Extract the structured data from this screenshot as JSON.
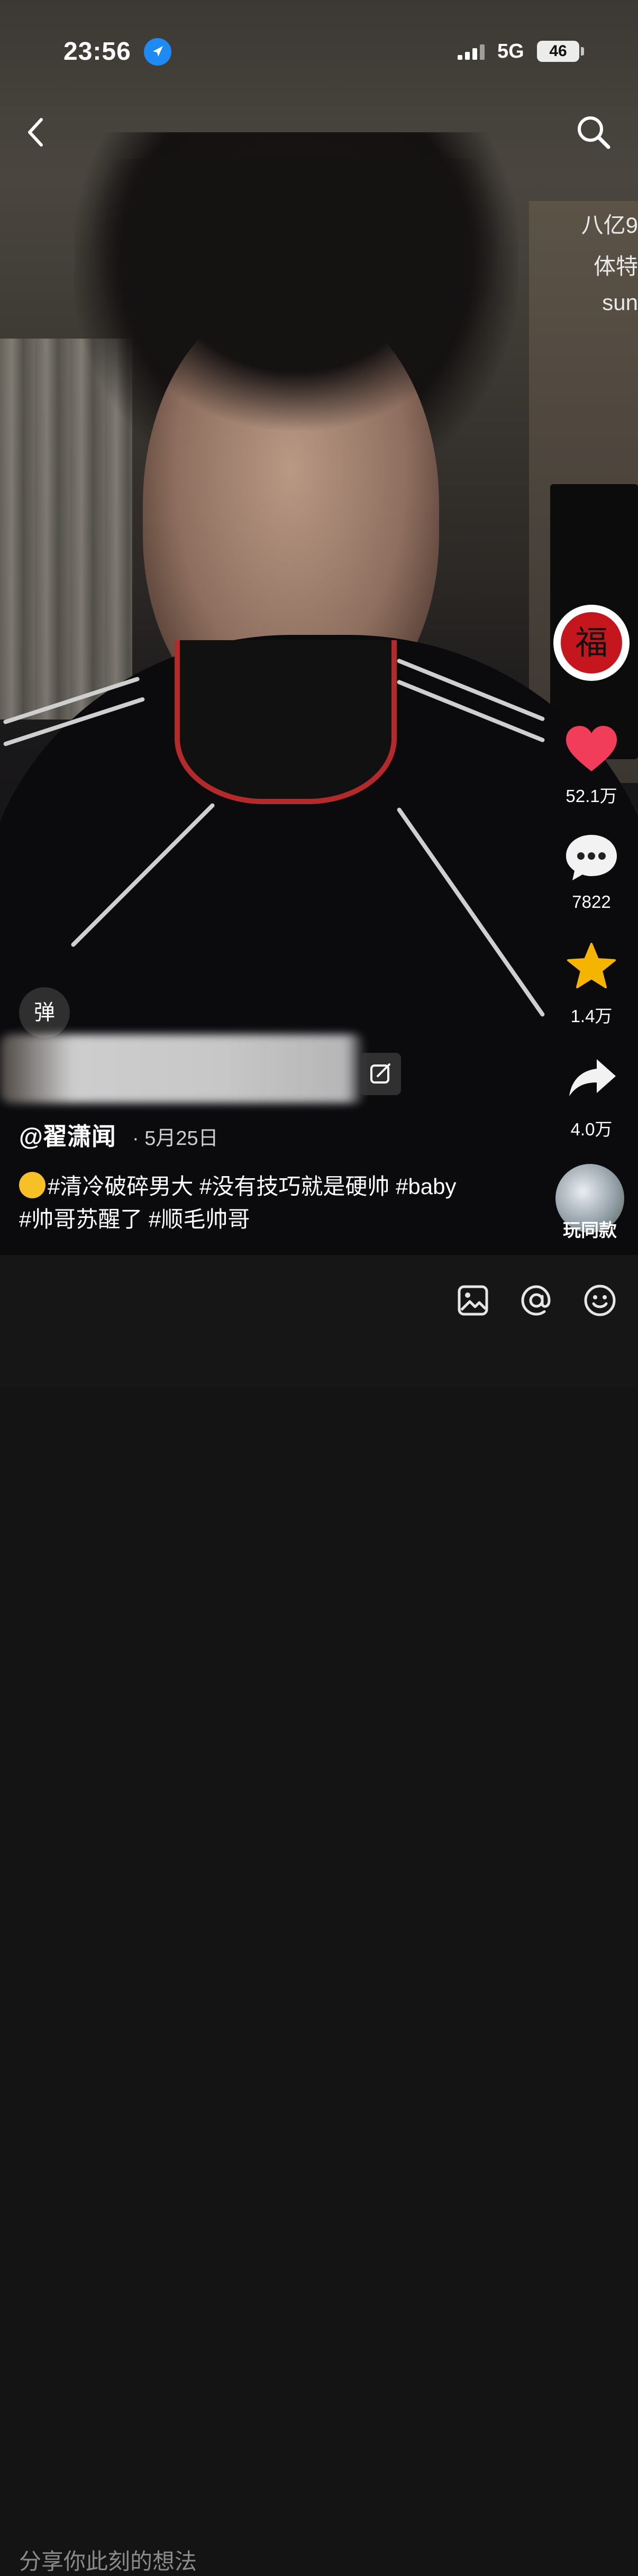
{
  "status_bar": {
    "time": "23:56",
    "network": "5G",
    "battery": "46"
  },
  "side_overlay_text": [
    "八亿9",
    "体特",
    "sun"
  ],
  "actions": {
    "like_count": "52.1万",
    "comment_count": "7822",
    "favorite_count": "1.4万",
    "share_count": "4.0万",
    "badge_char": "福"
  },
  "danmu_label": "弹",
  "post": {
    "author": "@翟潇闻",
    "date": "· 5月25日",
    "caption_line1": "#清冷破碎男大 #没有技巧就是硬帅 #baby",
    "caption_line2": "#帅哥苏醒了  #顺毛帅哥"
  },
  "same_style_label": "玩同款",
  "comment_bar": {
    "placeholder": "分享你此刻的想法"
  },
  "colors": {
    "like": "#f23d5a",
    "favorite": "#f5b400",
    "location": "#1e8bf5"
  }
}
